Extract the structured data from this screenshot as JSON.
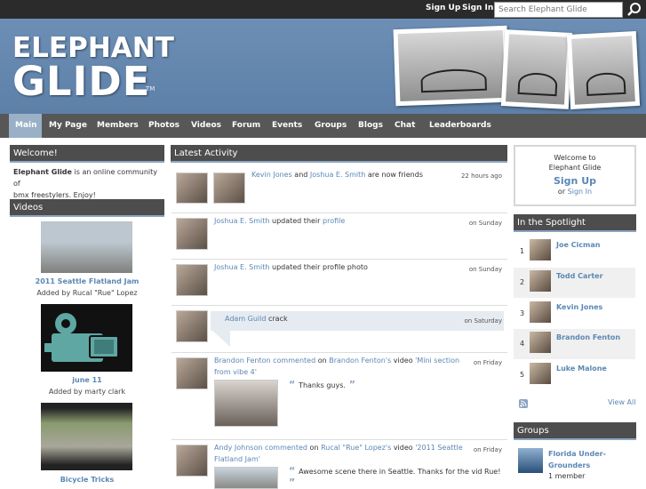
{
  "topbar": {
    "signup": "Sign Up",
    "signin": "Sign In",
    "search_placeholder": "Search Elephant Glide"
  },
  "logo": {
    "line1": "ELEPHANT",
    "line2": "GLIDE",
    "tm": "TM"
  },
  "nav": [
    "Main",
    "My Page",
    "Members",
    "Photos",
    "Videos",
    "Forum",
    "Events",
    "Groups",
    "Blogs",
    "Chat",
    "Leaderboards"
  ],
  "welcome": {
    "title": "Welcome!",
    "brand": "Elephant Glide",
    "text1": " is an online community of",
    "text2": "bmx freestylers. Enjoy!"
  },
  "videos": {
    "title": "Videos",
    "items": [
      {
        "title": "2011 Seattle Flatland Jam",
        "added": "Added by Rucal \"Rue\" Lopez"
      },
      {
        "title": "june 11",
        "added": "Added by marty clark"
      },
      {
        "title": "Bicycle Tricks",
        "added": ""
      }
    ]
  },
  "activity": {
    "title": "Latest Activity",
    "items": [
      {
        "who": "Kevin Jones",
        "mid": " and ",
        "who2": "Joshua E. Smith",
        "rest": " are now friends",
        "time": "22 hours ago"
      },
      {
        "who": "Joshua E. Smith",
        "mid": " updated their ",
        "link": "profile",
        "time": "on Sunday"
      },
      {
        "who": "Joshua E. Smith",
        "rest": " updated their profile photo",
        "time": "on Sunday"
      },
      {
        "who": "Adam Guild",
        "rest": " crack",
        "time": "on Saturday"
      },
      {
        "who": "Brandon Fenton",
        "verb": " commented",
        "mid": " on ",
        "who2": "Brandon Fenton's",
        "mid2": " video ",
        "link1": "'Mini section",
        "link2": "from vibe 4'",
        "quote": "Thanks guys.",
        "time": "on Friday"
      },
      {
        "who": "Andy Johnson",
        "verb": " commented",
        "mid": " on ",
        "who2": "Rucal \"Rue\" Lopez's",
        "mid2": " video ",
        "link1": "'2011 Seattle",
        "link2": "Flatland Jam'",
        "quote": "Awesome scene there in Seattle. Thanks for the vid Rue!",
        "time": "on Friday"
      }
    ]
  },
  "welcome_box": {
    "line1": "Welcome to",
    "line2": "Elephant Glide",
    "signup": "Sign Up",
    "or": "or ",
    "signin": "Sign In"
  },
  "spotlight": {
    "title": "In the Spotlight",
    "people": [
      {
        "num": "1",
        "name": "Joe Cicman"
      },
      {
        "num": "2",
        "name": "Todd Carter"
      },
      {
        "num": "3",
        "name": "Kevin Jones"
      },
      {
        "num": "4",
        "name": "Brandon Fenton"
      },
      {
        "num": "5",
        "name": "Luke Malone"
      }
    ],
    "view_all": "View All"
  },
  "groups": {
    "title": "Groups",
    "name1": "Florida Under-",
    "name2": "Grounders",
    "members": "1 member"
  },
  "colors": {
    "link": "#5b87b5",
    "header": "#6d8fb6",
    "nav": "#575757",
    "box_title": "#4d4d4d"
  }
}
